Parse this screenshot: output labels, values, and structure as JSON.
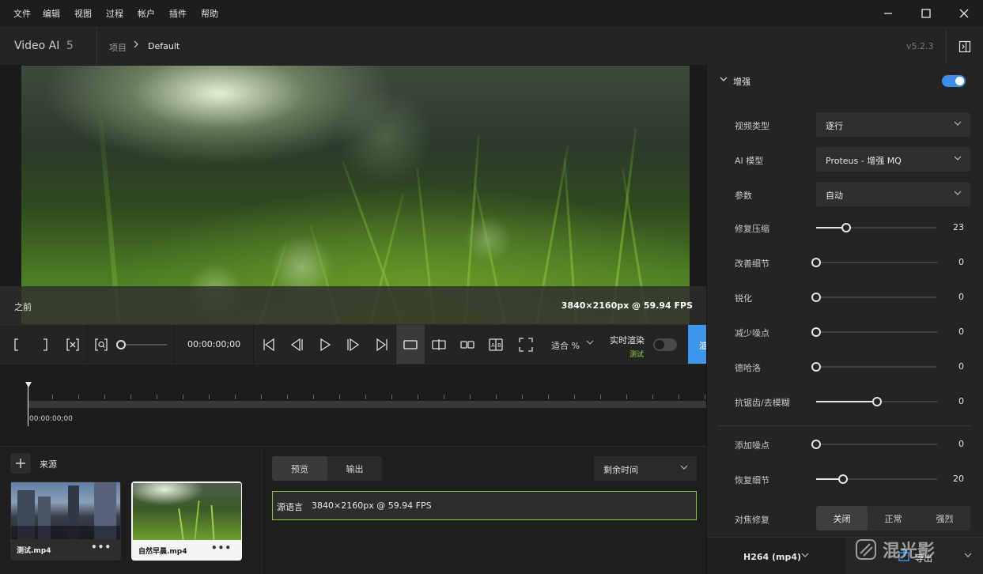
{
  "menu": [
    "文件",
    "编辑",
    "视图",
    "过程",
    "帐户",
    "插件",
    "帮助"
  ],
  "header": {
    "app_name": "Video AI",
    "app_version_major": "5",
    "breadcrumb_project": "项目",
    "breadcrumb_current": "Default",
    "version": "v5.2.3"
  },
  "viewer": {
    "label_before": "之前",
    "source_resolution": "3840×2160px @ 59.94 FPS"
  },
  "toolbar": {
    "timecode": "00:00:00;00",
    "fit_label": "适合 %",
    "realtime_label": "实时渲染",
    "beta_badge": "测试",
    "preview_button": "渲"
  },
  "timeline": {
    "time": "00:00:00;00"
  },
  "sources": {
    "title": "来源",
    "items": [
      {
        "name": "测试.mp4",
        "selected": false
      },
      {
        "name": "自然早晨.mp4",
        "selected": true
      }
    ]
  },
  "export_panel": {
    "tabs": [
      "预览",
      "输出"
    ],
    "active_tab": "预览",
    "remaining_label": "剩余时间",
    "source_line_label": "源语言",
    "source_line_value": "3840×2160px @ 59.94 FPS"
  },
  "right_panel": {
    "enhance_title": "增强",
    "enhance_enabled": true,
    "video_type": {
      "label": "视频类型",
      "value": "逐行"
    },
    "ai_model": {
      "label": "AI 模型",
      "value": "Proteus - 增强 MQ"
    },
    "params": {
      "label": "参数",
      "value": "自动"
    },
    "sliders": [
      {
        "label": "修复压缩",
        "value": 23
      },
      {
        "label": "改善细节",
        "value": 0
      },
      {
        "label": "锐化",
        "value": 0
      },
      {
        "label": "减少噪点",
        "value": 0
      },
      {
        "label": "德哈洛",
        "value": 0
      },
      {
        "label": "抗锯齿/去模糊",
        "value": 0
      },
      {
        "label": "添加噪点",
        "value": 0
      },
      {
        "label": "恢复细节",
        "value": 20
      }
    ],
    "slider_fill_fractions": [
      0.25,
      0,
      0,
      0,
      0,
      0.5,
      0,
      0.22
    ],
    "focus_fix": {
      "label": "对焦修复",
      "options": [
        "关闭",
        "正常",
        "强烈"
      ],
      "selected": "关闭"
    }
  },
  "export_bar": {
    "codec": "H264 (mp4)",
    "export_label": "导出",
    "watermark_text": "混光影"
  },
  "colors": {
    "accent_blue": "#3e95ea",
    "accent_green": "#8cc63f"
  }
}
